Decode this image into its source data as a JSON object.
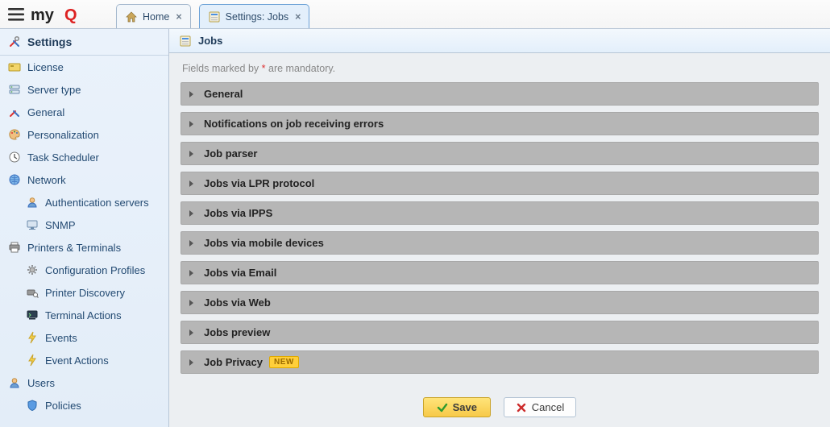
{
  "appbar": {
    "tabs": [
      {
        "label": "Home",
        "active": false
      },
      {
        "label": "Settings: Jobs",
        "active": true
      }
    ]
  },
  "sidebar": {
    "title": "Settings",
    "items": [
      {
        "label": "License"
      },
      {
        "label": "Server type"
      },
      {
        "label": "General"
      },
      {
        "label": "Personalization"
      },
      {
        "label": "Task Scheduler"
      },
      {
        "label": "Network"
      },
      {
        "label": "Authentication servers"
      },
      {
        "label": "SNMP"
      },
      {
        "label": "Printers & Terminals"
      },
      {
        "label": "Configuration Profiles"
      },
      {
        "label": "Printer Discovery"
      },
      {
        "label": "Terminal Actions"
      },
      {
        "label": "Events"
      },
      {
        "label": "Event Actions"
      },
      {
        "label": "Users"
      },
      {
        "label": "Policies"
      }
    ]
  },
  "main": {
    "title": "Jobs",
    "mandatory_before": "Fields marked by ",
    "mandatory_star": "*",
    "mandatory_after": " are mandatory.",
    "panels": [
      {
        "title": "General"
      },
      {
        "title": "Notifications on job receiving errors"
      },
      {
        "title": "Job parser"
      },
      {
        "title": "Jobs via LPR protocol"
      },
      {
        "title": "Jobs via IPPS"
      },
      {
        "title": "Jobs via mobile devices"
      },
      {
        "title": "Jobs via Email"
      },
      {
        "title": "Jobs via Web"
      },
      {
        "title": "Jobs preview"
      },
      {
        "title": "Job Privacy",
        "badge": "NEW"
      }
    ],
    "save_label": "Save",
    "cancel_label": "Cancel"
  }
}
